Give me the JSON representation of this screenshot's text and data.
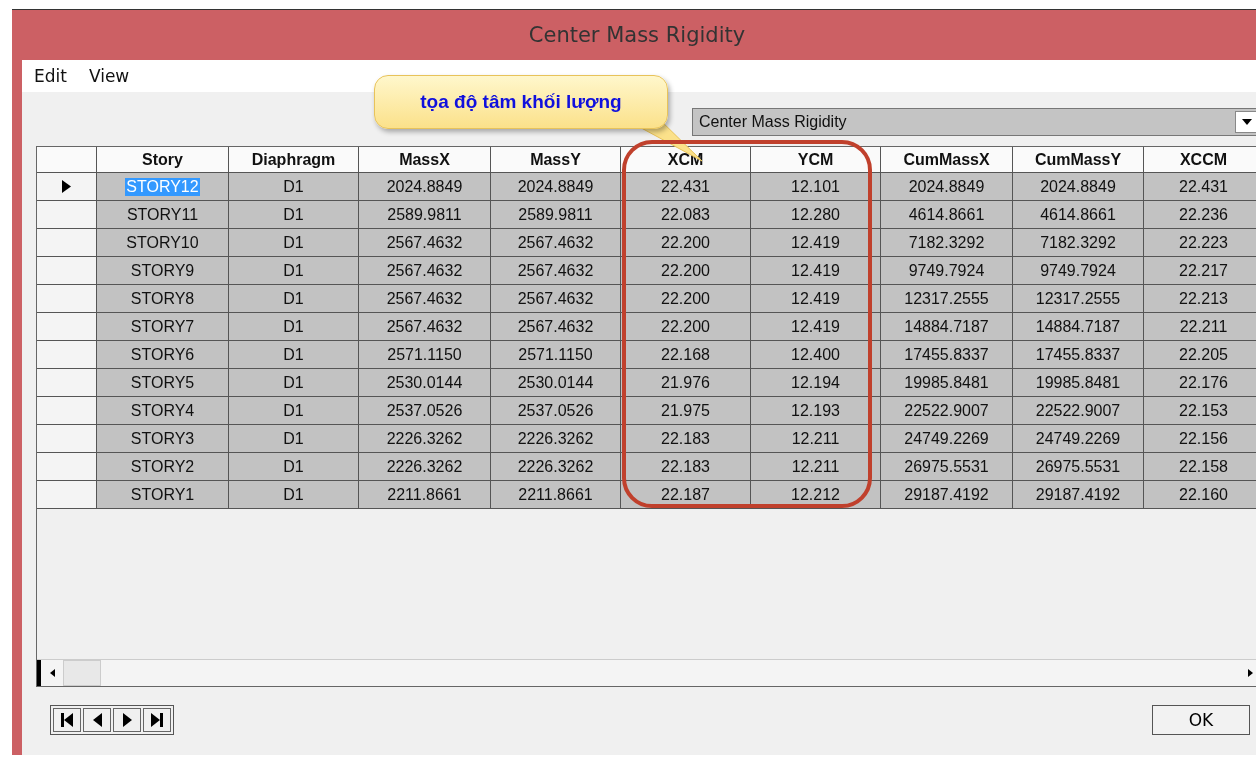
{
  "window": {
    "title": "Center Mass Rigidity"
  },
  "menu": [
    "Edit",
    "View"
  ],
  "callout": {
    "text": "tọa độ tâm khối lượng"
  },
  "table_select": {
    "value": "Center Mass Rigidity"
  },
  "grid": {
    "columns": [
      "Story",
      "Diaphragm",
      "MassX",
      "MassY",
      "XCM",
      "YCM",
      "CumMassX",
      "CumMassY",
      "XCCM"
    ],
    "rows": [
      {
        "selected": true,
        "cells": [
          "STORY12",
          "D1",
          "2024.8849",
          "2024.8849",
          "22.431",
          "12.101",
          "2024.8849",
          "2024.8849",
          "22.431"
        ]
      },
      {
        "selected": false,
        "cells": [
          "STORY11",
          "D1",
          "2589.9811",
          "2589.9811",
          "22.083",
          "12.280",
          "4614.8661",
          "4614.8661",
          "22.236"
        ]
      },
      {
        "selected": false,
        "cells": [
          "STORY10",
          "D1",
          "2567.4632",
          "2567.4632",
          "22.200",
          "12.419",
          "7182.3292",
          "7182.3292",
          "22.223"
        ]
      },
      {
        "selected": false,
        "cells": [
          "STORY9",
          "D1",
          "2567.4632",
          "2567.4632",
          "22.200",
          "12.419",
          "9749.7924",
          "9749.7924",
          "22.217"
        ]
      },
      {
        "selected": false,
        "cells": [
          "STORY8",
          "D1",
          "2567.4632",
          "2567.4632",
          "22.200",
          "12.419",
          "12317.2555",
          "12317.2555",
          "22.213"
        ]
      },
      {
        "selected": false,
        "cells": [
          "STORY7",
          "D1",
          "2567.4632",
          "2567.4632",
          "22.200",
          "12.419",
          "14884.7187",
          "14884.7187",
          "22.211"
        ]
      },
      {
        "selected": false,
        "cells": [
          "STORY6",
          "D1",
          "2571.1150",
          "2571.1150",
          "22.168",
          "12.400",
          "17455.8337",
          "17455.8337",
          "22.205"
        ]
      },
      {
        "selected": false,
        "cells": [
          "STORY5",
          "D1",
          "2530.0144",
          "2530.0144",
          "21.976",
          "12.194",
          "19985.8481",
          "19985.8481",
          "22.176"
        ]
      },
      {
        "selected": false,
        "cells": [
          "STORY4",
          "D1",
          "2537.0526",
          "2537.0526",
          "21.975",
          "12.193",
          "22522.9007",
          "22522.9007",
          "22.153"
        ]
      },
      {
        "selected": false,
        "cells": [
          "STORY3",
          "D1",
          "2226.3262",
          "2226.3262",
          "22.183",
          "12.211",
          "24749.2269",
          "24749.2269",
          "22.156"
        ]
      },
      {
        "selected": false,
        "cells": [
          "STORY2",
          "D1",
          "2226.3262",
          "2226.3262",
          "22.183",
          "12.211",
          "26975.5531",
          "26975.5531",
          "22.158"
        ]
      },
      {
        "selected": false,
        "cells": [
          "STORY1",
          "D1",
          "2211.8661",
          "2211.8661",
          "22.187",
          "12.212",
          "29187.4192",
          "29187.4192",
          "22.160"
        ]
      }
    ]
  },
  "buttons": [
    "OK"
  ]
}
